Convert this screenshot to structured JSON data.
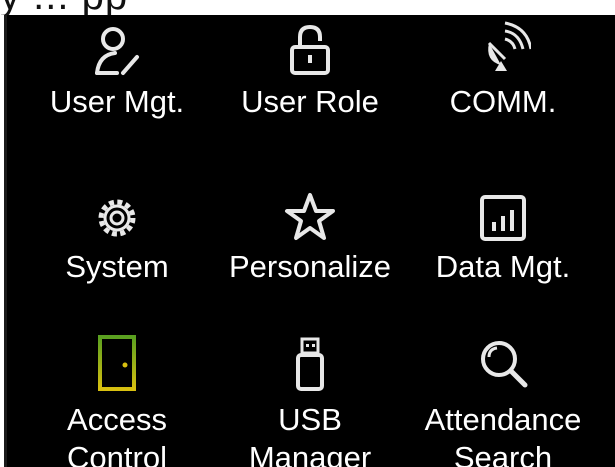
{
  "header_partial_text": "y ... pp",
  "menu": {
    "items": [
      {
        "label": "User Mgt.",
        "icon": "user-edit-icon"
      },
      {
        "label": "User Role",
        "icon": "lock-icon"
      },
      {
        "label": "COMM.",
        "icon": "satellite-dish-icon"
      },
      {
        "label": "System",
        "icon": "gear-icon"
      },
      {
        "label": "Personalize",
        "icon": "star-icon"
      },
      {
        "label": "Data Mgt.",
        "icon": "bar-chart-icon"
      },
      {
        "label": "Access",
        "label_line2": "Control",
        "icon": "door-icon"
      },
      {
        "label": "USB",
        "label_line2": "Manager",
        "icon": "usb-drive-icon"
      },
      {
        "label": "Attendance",
        "label_line2": "Search",
        "icon": "magnifier-icon"
      }
    ]
  },
  "colors": {
    "background": "#000000",
    "text": "#ffffff",
    "icon": "#e8e8e8",
    "door_icon": "#c8c010"
  }
}
